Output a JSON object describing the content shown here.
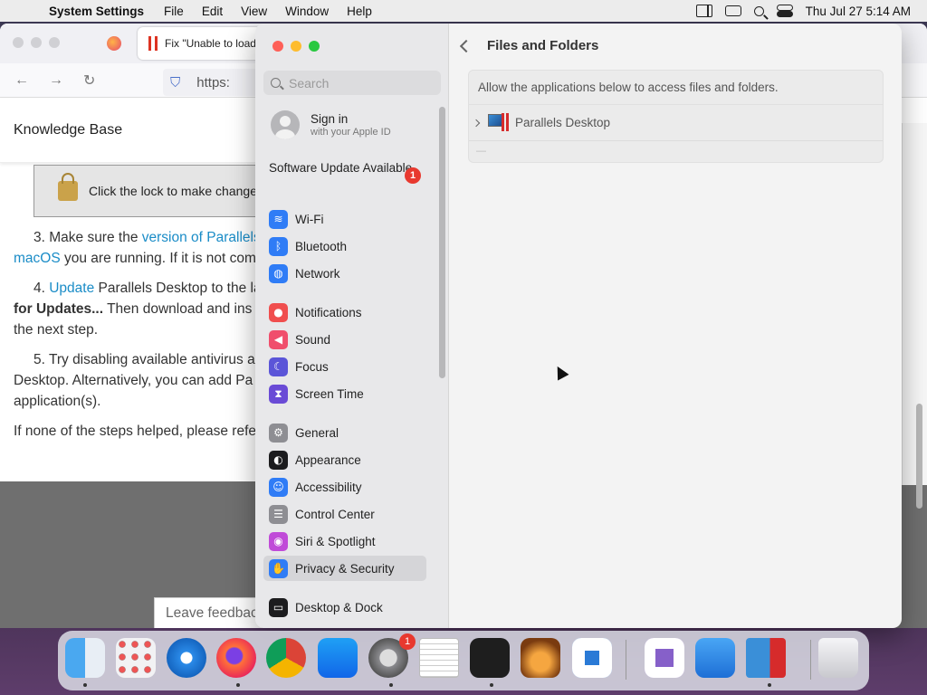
{
  "menubar": {
    "app_name": "System Settings",
    "menus": [
      "File",
      "Edit",
      "View",
      "Window",
      "Help"
    ],
    "clock": "Thu Jul 27  5:14 AM"
  },
  "browser": {
    "tab_title": "Fix \"Unable to load",
    "url": "https:",
    "kb_header": "Knowledge Base",
    "lock_text": "Click the lock to make change",
    "step3_prefix": "3. Make sure the ",
    "step3_link": "version of Parallels",
    "step3_link2": "macOS",
    "step3_rest": " you are running. If it is not com",
    "step4_link": "Update",
    "step4_text": " Parallels Desktop to the la",
    "step4_bold": "for Updates...",
    "step4_rest": " Then download and ins",
    "step4_end": "the next step.",
    "step5_a": "5. Try disabling available antivirus ap",
    "step5_b": "Desktop. Alternatively, you can add Pa",
    "step5_c": "application(s).",
    "footer_text": "If none of the steps helped, please refe",
    "feedback": "Leave feedbac"
  },
  "settings": {
    "search_placeholder": "Search",
    "signin_title": "Sign in",
    "signin_sub": "with your Apple ID",
    "update_label": "Software Update Available",
    "update_badge": "1",
    "sidebar_items": [
      {
        "label": "Wi-Fi",
        "icon": "wifi-icon",
        "color": "#2f7cf6"
      },
      {
        "label": "Bluetooth",
        "icon": "bluetooth-icon",
        "color": "#2f7cf6"
      },
      {
        "label": "Network",
        "icon": "globe-icon",
        "color": "#2f7cf6"
      },
      {
        "label": "Notifications",
        "icon": "bell-icon",
        "color": "#f04e4e"
      },
      {
        "label": "Sound",
        "icon": "speaker-icon",
        "color": "#f04e6c"
      },
      {
        "label": "Focus",
        "icon": "moon-icon",
        "color": "#5b55d8"
      },
      {
        "label": "Screen Time",
        "icon": "hourglass-icon",
        "color": "#6a4bd6"
      },
      {
        "label": "General",
        "icon": "gear-icon",
        "color": "#8e8e93"
      },
      {
        "label": "Appearance",
        "icon": "appearance-icon",
        "color": "#1c1c1e"
      },
      {
        "label": "Accessibility",
        "icon": "accessibility-icon",
        "color": "#2f7cf6"
      },
      {
        "label": "Control Center",
        "icon": "control-center-icon",
        "color": "#8e8e93"
      },
      {
        "label": "Siri & Spotlight",
        "icon": "siri-icon",
        "color": "#c04bd8"
      },
      {
        "label": "Privacy & Security",
        "icon": "hand-icon",
        "color": "#2f7cf6"
      },
      {
        "label": "Desktop & Dock",
        "icon": "dock-icon",
        "color": "#1c1c1e"
      }
    ],
    "page_title": "Files and Folders",
    "panel_desc": "Allow the applications below to access files and folders.",
    "app_row": "Parallels Desktop",
    "minus": "—"
  },
  "dock": {
    "badge": "1",
    "apps": [
      "finder-icon",
      "launchpad-icon",
      "safari-icon",
      "firefox-icon",
      "chrome-icon",
      "app-store-icon",
      "system-settings-icon",
      "textedit-icon",
      "terminal-icon",
      "garageband-icon",
      "vscode-icon",
      "visual-studio-icon",
      "weather-icon",
      "parallels-icon",
      "trash-icon"
    ]
  }
}
